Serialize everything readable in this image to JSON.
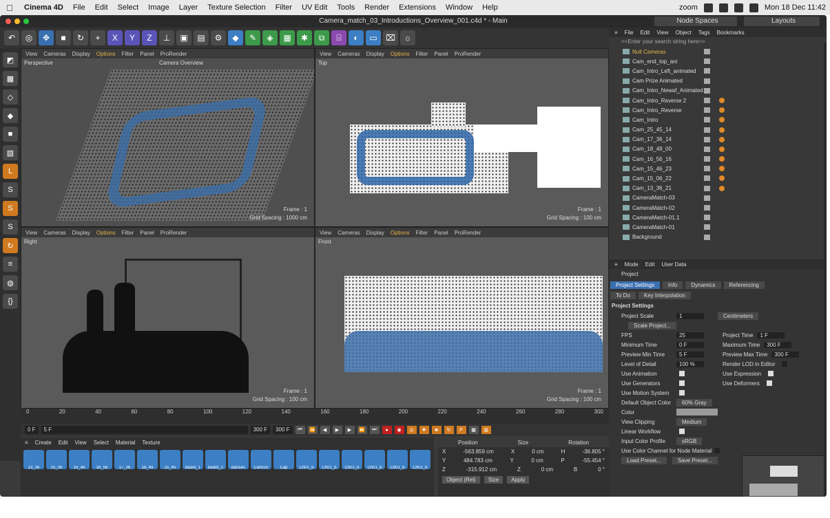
{
  "menubar": {
    "apple": "",
    "app": "Cinema 4D",
    "items": [
      "File",
      "Edit",
      "Select",
      "Image",
      "Layer",
      "Texture Selection",
      "Filter",
      "UV Edit",
      "Tools",
      "Render",
      "Extensions",
      "Window",
      "Help"
    ],
    "zoom_label": "zoom",
    "datetime": "Mon 18 Dec 11:42"
  },
  "window": {
    "title": "Camera_match_03_Introductions_Overview_001.c4d * - Main",
    "node_spaces": "Node Spaces",
    "layouts": "Layouts"
  },
  "viewports": {
    "menu": [
      "View",
      "Cameras",
      "Display",
      "Options",
      "Filter",
      "Panel",
      "ProRender"
    ],
    "perspective": {
      "name": "Perspective",
      "camera": "Camera Overview",
      "frame": "Frame : 1",
      "grid": "Grid Spacing : 1000 cm"
    },
    "top": {
      "name": "Top",
      "frame": "Frame : 1",
      "grid": "Grid Spacing : 100 cm"
    },
    "right": {
      "name": "Right",
      "frame": "Frame : 1",
      "grid": "Grid Spacing : 100 cm"
    },
    "front": {
      "name": "Front",
      "frame": "Frame : 1",
      "grid": "Grid Spacing : 100 cm"
    }
  },
  "timeline": {
    "ticks": [
      "0",
      "20",
      "40",
      "60",
      "80",
      "100",
      "120",
      "140",
      "160",
      "180",
      "200",
      "220",
      "240",
      "260",
      "280",
      "300"
    ],
    "current": "0 F",
    "start": "5 F",
    "end": "300 F",
    "end2": "300 F",
    "frame_box": "1 F"
  },
  "materials": {
    "menu": [
      "Create",
      "Edit",
      "View",
      "Select",
      "Material",
      "Texture"
    ],
    "row1": [
      "13_36",
      "15_06",
      "16_48",
      "16_56",
      "17_36",
      "18_49",
      "25_45",
      "beard_1",
      "beard_2",
      "Banses",
      "Camcor",
      "Cap",
      "Ch01_b",
      "Ch01_b",
      "Ch01_b",
      "Ch01_b",
      "Ch01_b",
      "Ch01_b"
    ]
  },
  "coords": {
    "headers": [
      "Position",
      "Size",
      "Rotation"
    ],
    "rows": [
      [
        "X",
        "-563.859 cm",
        "X",
        "0 cm",
        "H",
        "-36.805 °"
      ],
      [
        "Y",
        "484.783 cm",
        "Y",
        "0 cm",
        "P",
        "-55.454 °"
      ],
      [
        "Z",
        "-315.912 cm",
        "Z",
        "0 cm",
        "B",
        "0 °"
      ]
    ],
    "mode": "Object (Rel)",
    "size_mode": "Size",
    "apply": "Apply"
  },
  "objects": {
    "menu": [
      "File",
      "Edit",
      "View",
      "Object",
      "Tags",
      "Bookmarks"
    ],
    "search": "<<Enter your search string here>>",
    "items": [
      "Null Cameras",
      "Cam_end_top_ani",
      "Cam_Intro_Left_animated",
      "Cam Prize Animated",
      "Cam_Intro_Newaf_Animated",
      "Cam_Intro_Reverse 2",
      "Cam_Intro_Reverse",
      "Cam_Intro",
      "Cam_25_45_14",
      "Cam_17_36_14",
      "Cam_18_49_00",
      "Cam_16_56_16",
      "Cam_15_46_23",
      "Cam_15_06_22",
      "Cam_13_36_21",
      "CameraMatch-03",
      "CameraMatch-02",
      "CameraMatch-01.1",
      "CameraMatch-01",
      "Background"
    ]
  },
  "attributes": {
    "menu": [
      "Mode",
      "Edit",
      "User Data"
    ],
    "project": "Project",
    "tabs": [
      "Project Settings",
      "Info",
      "Dynamics",
      "Referencing"
    ],
    "tabs2": [
      "To Do",
      "Key Interpolation"
    ],
    "section": "Project Settings",
    "scale_label": "Project Scale",
    "scale_val": "1",
    "scale_unit": "Centimeters",
    "scale_btn": "Scale Project...",
    "fps_label": "FPS",
    "fps": "25",
    "ptime_label": "Project Time",
    "ptime": "1 F",
    "min_label": "Minimum Time",
    "min": "0 F",
    "max_label": "Maximum Time",
    "max": "300 F",
    "pmin_label": "Preview Min Time",
    "pmin": "5 F",
    "pmax_label": "Preview Max Time",
    "pmax": "300 F",
    "lod_label": "Level of Detail",
    "lod": "100 %",
    "rlod_label": "Render LOD in Editor",
    "anim": "Use Animation",
    "expr": "Use Expression",
    "gen": "Use Generators",
    "def": "Use Deformers",
    "motion": "Use Motion System",
    "doc_label": "Default Object Color",
    "doc_val": "60% Gray",
    "color_label": "Color",
    "clip_label": "View Clipping",
    "clip_val": "Medium",
    "lw_label": "Linear Workflow",
    "icp_label": "Input Color Profile",
    "icp_val": "sRGB",
    "ucc_label": "Use Color Channel for Node Material",
    "load_btn": "Load Preset...",
    "save_btn": "Save Preset..."
  }
}
